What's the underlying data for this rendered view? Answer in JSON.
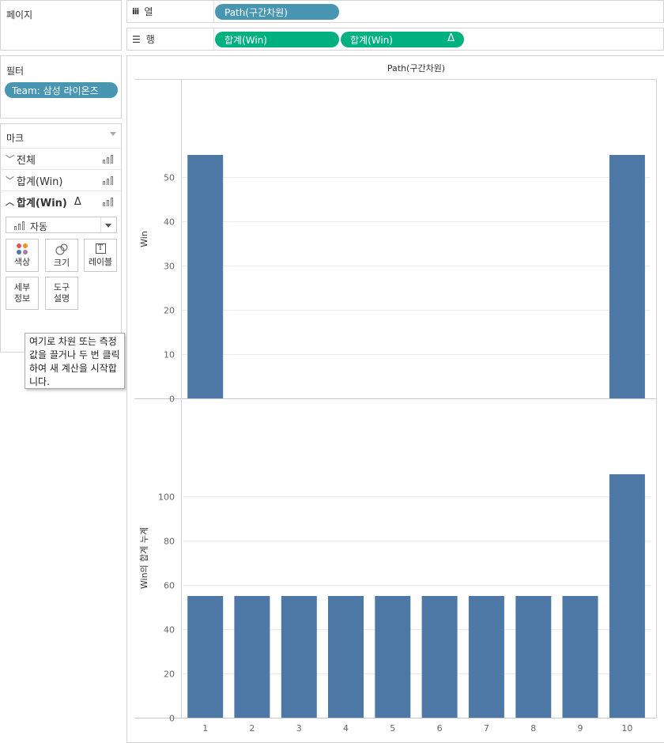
{
  "pages_card": {
    "title": "페이지"
  },
  "columns_shelf": {
    "label": "열",
    "pills": [
      {
        "text": "Path(구간차원)"
      }
    ]
  },
  "rows_shelf": {
    "label": "행",
    "pills": [
      {
        "text": "합계(Win)"
      },
      {
        "text": "합계(Win)",
        "delta": "Δ"
      }
    ]
  },
  "filters_card": {
    "title": "필터",
    "pills": [
      {
        "text": "Team: 삼성 라이온즈"
      }
    ]
  },
  "marks_card": {
    "title": "마크",
    "rows": [
      {
        "label": "전체",
        "chevron": "﹀"
      },
      {
        "label": "합계(Win)",
        "chevron": "﹀"
      },
      {
        "label": "합계(Win)",
        "chevron": "︿",
        "delta": "Δ"
      }
    ],
    "mark_type": "자동",
    "buttons": [
      {
        "label": "색상",
        "icon": "color-dots-icon"
      },
      {
        "label": "크기",
        "icon": "size-circles-icon"
      },
      {
        "label": "레이블",
        "icon": "label-t-icon"
      },
      {
        "label": "세부\n정보",
        "icon": ""
      },
      {
        "label": "도구\n설명",
        "icon": ""
      }
    ]
  },
  "tooltip": {
    "text": "여기로 차원 또는 측정값을 끌거나 두 번 클릭하여 새 계산을 시작합니다."
  },
  "chart_data": [
    {
      "type": "bar",
      "header": "Path(구간차원)",
      "ylabel": "Win",
      "categories": [
        "1",
        "2",
        "3",
        "4",
        "5",
        "6",
        "7",
        "8",
        "9",
        "10"
      ],
      "values": [
        55,
        null,
        null,
        null,
        null,
        null,
        null,
        null,
        null,
        55
      ],
      "ylim": [
        0,
        55
      ],
      "yticks": [
        0,
        10,
        20,
        30,
        40,
        50
      ],
      "grid": true,
      "color": "#4e79a7"
    },
    {
      "type": "bar",
      "ylabel": "Win의 합계 누계",
      "categories": [
        "1",
        "2",
        "3",
        "4",
        "5",
        "6",
        "7",
        "8",
        "9",
        "10"
      ],
      "values": [
        55,
        55,
        55,
        55,
        55,
        55,
        55,
        55,
        55,
        110
      ],
      "ylim": [
        0,
        110
      ],
      "yticks": [
        0,
        20,
        40,
        60,
        80,
        100
      ],
      "grid": true,
      "color": "#4e79a7"
    }
  ]
}
